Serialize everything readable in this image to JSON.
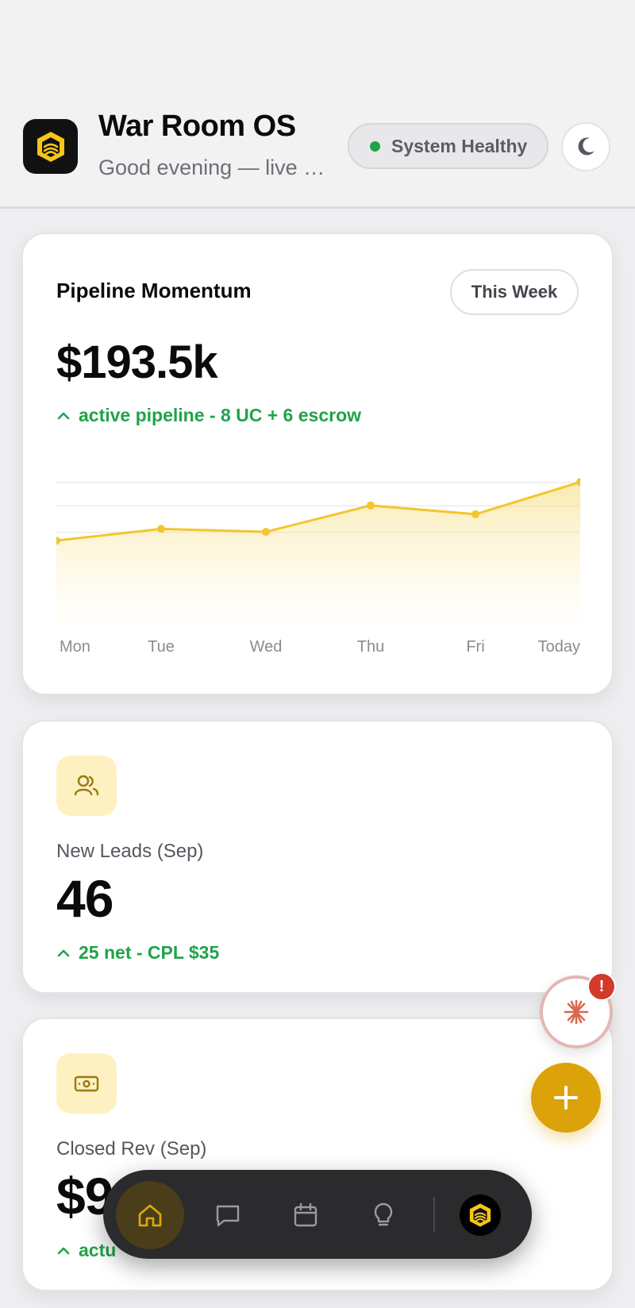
{
  "header": {
    "title": "War Room OS",
    "greeting": "Good evening — live dashboard",
    "status": "System Healthy",
    "status_color": "#1fa34a"
  },
  "pipeline": {
    "title": "Pipeline Momentum",
    "range": "This Week",
    "value": "$193.5k",
    "trend": "active pipeline - 8 UC + 6 escrow"
  },
  "chart_data": {
    "type": "area",
    "categories": [
      "Mon",
      "Tue",
      "Wed",
      "Thu",
      "Fri",
      "Today"
    ],
    "values": [
      140,
      152,
      149,
      176,
      167,
      200
    ],
    "ylim": [
      80,
      210
    ],
    "grid": true,
    "color": "#f2c62f"
  },
  "leads": {
    "label": "New Leads (Sep)",
    "value": "46",
    "trend": "25 net - CPL $35"
  },
  "revenue": {
    "label": "Closed Rev (Sep)",
    "value": "$9",
    "trend": "actu"
  },
  "alert": {
    "badge": "!"
  },
  "nav": {
    "items": [
      "home-icon",
      "chat-icon",
      "calendar-icon",
      "lightbulb-icon",
      "brand-logo"
    ],
    "active": "home"
  },
  "colors": {
    "accent": "#dba20a",
    "positive": "#1fa34a",
    "alert": "#d23a2b"
  }
}
